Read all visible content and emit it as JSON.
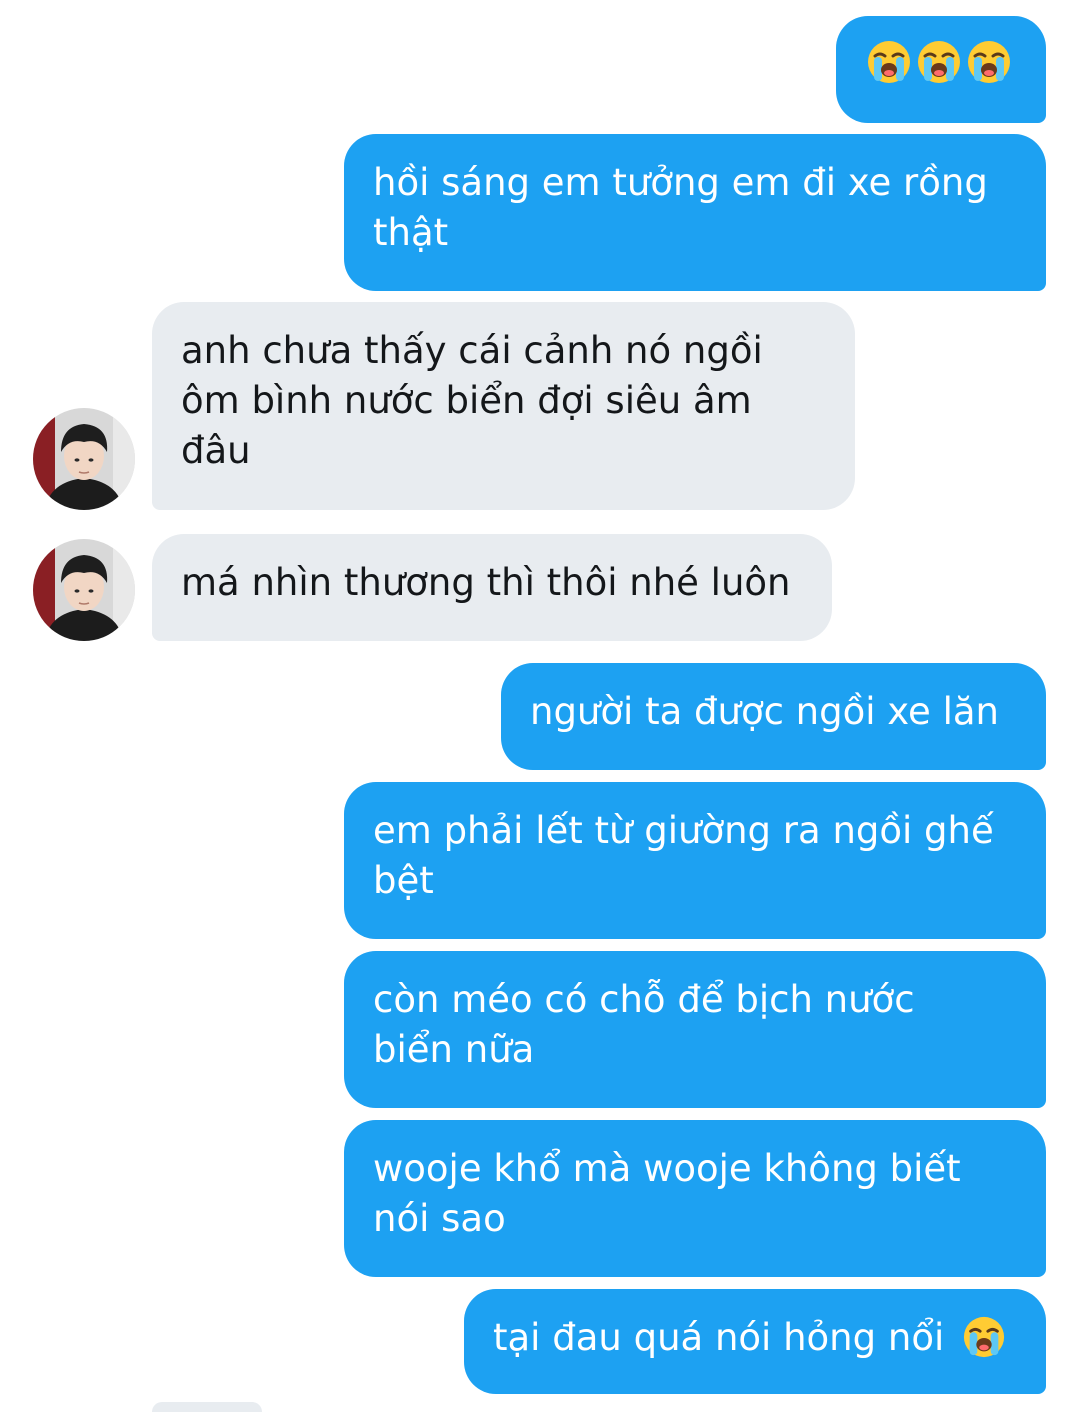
{
  "colors": {
    "outgoing_bubble": "#1da1f2",
    "incoming_bubble": "#e8ecf0",
    "outgoing_text": "#ffffff",
    "incoming_text": "#14171a"
  },
  "messages": [
    {
      "sender": "me",
      "text": "",
      "emojis": [
        "loudly-crying-face",
        "loudly-crying-face",
        "loudly-crying-face"
      ]
    },
    {
      "sender": "me",
      "text": "hồi sáng em tưởng em đi xe rồng thật"
    },
    {
      "sender": "them",
      "text": "anh chưa thấy cái cảnh nó ngồi ôm bình nước biển đợi siêu âm đâu"
    },
    {
      "sender": "them",
      "text": "má nhìn thương thì thôi nhé luôn"
    },
    {
      "sender": "me",
      "text": "người ta được ngồi xe lăn"
    },
    {
      "sender": "me",
      "text": "em phải lết từ giường ra ngồi ghế bệt"
    },
    {
      "sender": "me",
      "text": "còn méo có chỗ để bịch nước biển nữa"
    },
    {
      "sender": "me",
      "text": "wooje khổ mà wooje không biết nói sao"
    },
    {
      "sender": "me",
      "text": "tại đau quá nói hỏng nổi",
      "emojis": [
        "loudly-crying-face"
      ]
    }
  ]
}
